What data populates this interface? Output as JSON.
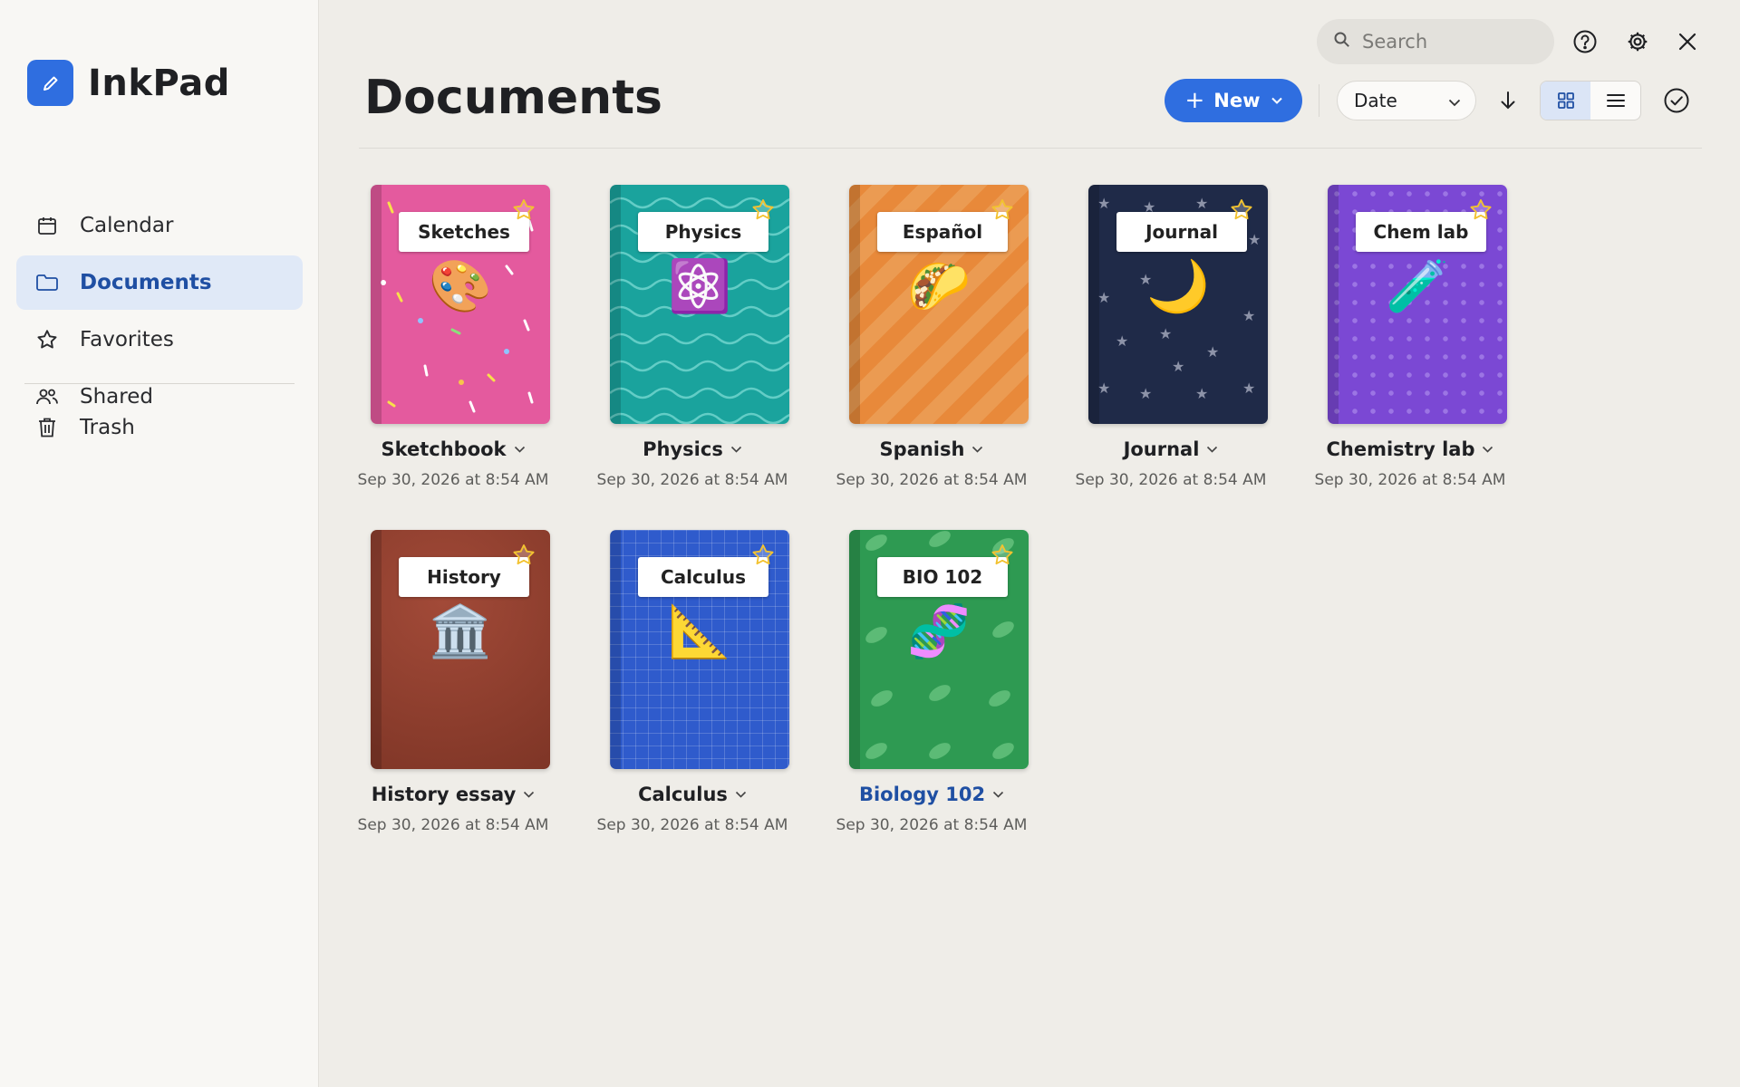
{
  "app": {
    "name": "InkPad"
  },
  "sidebar": {
    "items": [
      {
        "label": "Calendar",
        "icon": "calendar-icon"
      },
      {
        "label": "Documents",
        "icon": "folder-icon",
        "active": true
      },
      {
        "label": "Favorites",
        "icon": "star-icon"
      },
      {
        "label": "Shared",
        "icon": "people-icon"
      }
    ],
    "trash": {
      "label": "Trash",
      "icon": "trash-icon"
    }
  },
  "header": {
    "title": "Documents",
    "search": {
      "placeholder": "Search",
      "value": ""
    },
    "new_label": "New",
    "sort": {
      "selected": "Date"
    }
  },
  "colors": {
    "accent": "#2f6ee0",
    "active_nav_bg": "#e0e9f7",
    "background": "#efede8"
  },
  "notebooks": [
    {
      "label": "Sketches",
      "emoji": "🎨",
      "title": "Sketchbook",
      "date": "Sep 30, 2026 at 8:54 AM",
      "color": "#e45a9e"
    },
    {
      "label": "Physics",
      "emoji": "⚛️",
      "title": "Physics",
      "date": "Sep 30, 2026 at 8:54 AM",
      "color": "#1aa39d"
    },
    {
      "label": "Español",
      "emoji": "🌮",
      "title": "Spanish",
      "date": "Sep 30, 2026 at 8:54 AM",
      "color": "#e8893a"
    },
    {
      "label": "Journal",
      "emoji": "🌙",
      "title": "Journal",
      "date": "Sep 30, 2026 at 8:54 AM",
      "color": "#1f2a48"
    },
    {
      "label": "Chem lab",
      "emoji": "🧪",
      "title": "Chemistry lab",
      "date": "Sep 30, 2026 at 8:54 AM",
      "color": "#7b48d4"
    },
    {
      "label": "History",
      "emoji": "🏛️",
      "title": "History essay",
      "date": "Sep 30, 2026 at 8:54 AM",
      "color": "#8f3f2e"
    },
    {
      "label": "Calculus",
      "emoji": "📐",
      "title": "Calculus",
      "date": "Sep 30, 2026 at 8:54 AM",
      "color": "#2f5bcc"
    },
    {
      "label": "BIO 102",
      "emoji": "🧬",
      "title": "Biology 102",
      "date": "Sep 30, 2026 at 8:54 AM",
      "color": "#2e9a52",
      "highlighted": true
    }
  ]
}
